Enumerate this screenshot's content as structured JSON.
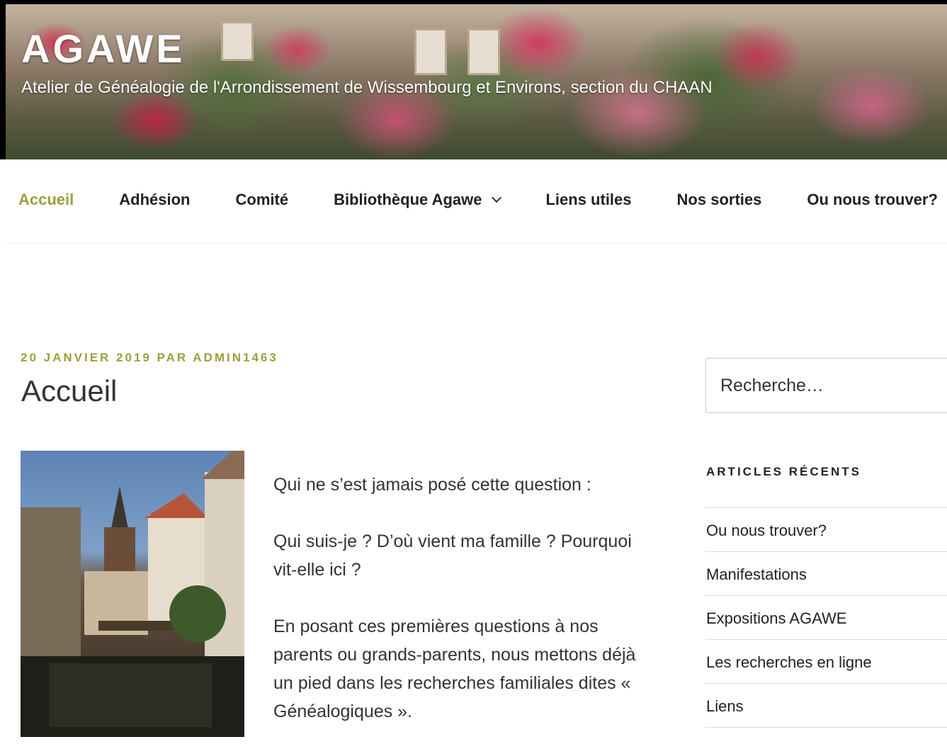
{
  "site": {
    "title": "AGAWE",
    "description": "Atelier de Généalogie de l'Arrondissement de Wissembourg et Environs, section du CHAAN"
  },
  "nav": {
    "items": [
      {
        "label": "Accueil",
        "current": true
      },
      {
        "label": "Adhésion"
      },
      {
        "label": "Comité"
      },
      {
        "label": "Bibliothèque Agawe",
        "has_submenu": true
      },
      {
        "label": "Liens utiles"
      },
      {
        "label": "Nos sorties"
      },
      {
        "label": "Ou nous trouver?"
      }
    ]
  },
  "post": {
    "meta": "20 janvier 2019 par admin1463",
    "title": "Accueil",
    "image_icon": "town-canal-photo",
    "paragraphs": [
      "Qui ne s’est jamais posé cette question :",
      "Qui suis-je ? D’où vient ma famille ? Pourquoi vit-elle ici ?",
      "En posant ces premières questions à nos parents ou grands-parents, nous mettons déjà un pied dans les recherches familiales dites « Généalogiques »."
    ]
  },
  "sidebar": {
    "search_placeholder": "Recherche…",
    "recent_title": "Articles récents",
    "recent": [
      "Ou nous trouver?",
      "Manifestations",
      "Expositions AGAWE",
      "Les recherches en ligne",
      "Liens"
    ]
  },
  "colors": {
    "accent": "#9ba03a"
  }
}
